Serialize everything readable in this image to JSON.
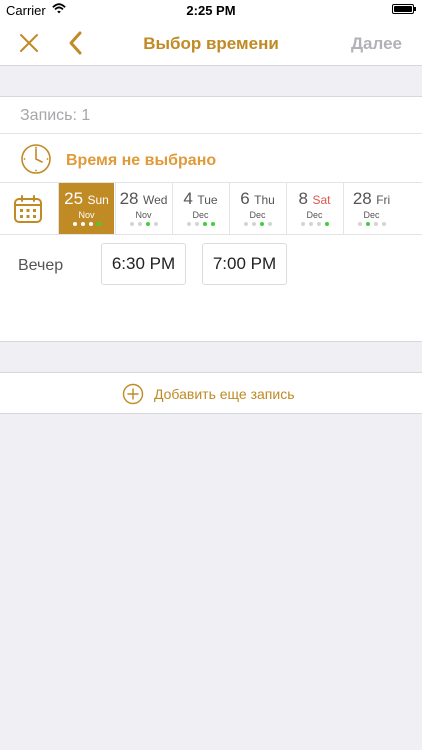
{
  "status_bar": {
    "carrier": "Carrier",
    "time": "2:25 PM"
  },
  "nav": {
    "title": "Выбор времени",
    "next_label": "Далее",
    "close_icon": "close-icon",
    "back_icon": "chevron-left-icon"
  },
  "record": {
    "label": "Запись: 1"
  },
  "time_status": {
    "text": "Время не выбрано",
    "icon": "clock-icon"
  },
  "dates": [
    {
      "day": "25",
      "weekday": "Sun",
      "month": "Nov",
      "selected": true,
      "weekend": false,
      "dots": [
        "grey",
        "grey",
        "grey",
        "green"
      ]
    },
    {
      "day": "28",
      "weekday": "Wed",
      "month": "Nov",
      "selected": false,
      "weekend": false,
      "dots": [
        "grey",
        "grey",
        "green",
        "grey"
      ]
    },
    {
      "day": "4",
      "weekday": "Tue",
      "month": "Dec",
      "selected": false,
      "weekend": false,
      "dots": [
        "grey",
        "grey",
        "green",
        "green"
      ]
    },
    {
      "day": "6",
      "weekday": "Thu",
      "month": "Dec",
      "selected": false,
      "weekend": false,
      "dots": [
        "grey",
        "grey",
        "green",
        "grey"
      ]
    },
    {
      "day": "8",
      "weekday": "Sat",
      "month": "Dec",
      "selected": false,
      "weekend": true,
      "dots": [
        "grey",
        "grey",
        "grey",
        "green"
      ]
    },
    {
      "day": "28",
      "weekday": "Fri",
      "month": "Dec",
      "selected": false,
      "weekend": false,
      "dots": [
        "grey",
        "green",
        "grey",
        "grey"
      ]
    }
  ],
  "slots": {
    "label": "Вечер",
    "times": [
      "6:30 PM",
      "7:00 PM"
    ]
  },
  "add_record": {
    "label": "Добавить еще запись",
    "icon": "plus-circle-icon"
  },
  "colors": {
    "accent": "#c08a25",
    "status_orange": "#e19a3a",
    "available_dot": "#3bd13b",
    "weekend": "#e0564c",
    "disabled": "#b2b2b6"
  }
}
